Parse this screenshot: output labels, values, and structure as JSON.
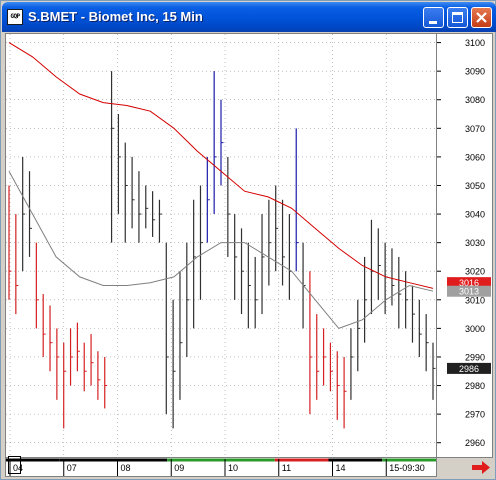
{
  "window": {
    "title": "S.BMET - Biomet Inc, 15 Min",
    "app_icon_text": "GQP"
  },
  "colors": {
    "up_bar": "#1a1aa8",
    "down_bar": "#d42020",
    "neutral_bar": "#303030",
    "moving_average_long": "#d40000",
    "moving_average_short": "#808080",
    "label_red_bg": "#e01c1c",
    "label_gray_bg": "#a0a0a0",
    "label_black_bg": "#202020"
  },
  "price_axis": {
    "ticks": [
      "3100",
      "3090",
      "3080",
      "3070",
      "3060",
      "3050",
      "3040",
      "3030",
      "3020",
      "3010",
      "3000",
      "2990",
      "2980",
      "2970",
      "2960"
    ],
    "tick_values": [
      3100,
      3090,
      3080,
      3070,
      3060,
      3050,
      3040,
      3030,
      3020,
      3010,
      3000,
      2990,
      2980,
      2970,
      2960
    ],
    "markers": [
      {
        "label": "3016",
        "value": 3016,
        "style": "red"
      },
      {
        "label": "3013",
        "value": 3013,
        "style": "gray"
      },
      {
        "label": "2986",
        "value": 2986,
        "style": "black"
      }
    ]
  },
  "time_axis": {
    "labels": [
      "04",
      "07",
      "08",
      "09",
      "10",
      "11",
      "14",
      "15-09:30"
    ],
    "segment_colors": [
      "#000000",
      "#000000",
      "#000000",
      "#2a9a2a",
      "#2a9a2a",
      "#d42020",
      "#000000",
      "#2a9a2a"
    ]
  },
  "chart_data": {
    "type": "line",
    "y_range": [
      2955,
      3103
    ],
    "grid": true,
    "series": [
      {
        "style": "ohlc-bars",
        "bars": [
          {
            "x": 0,
            "h": 3050,
            "l": 3010,
            "c": 3020,
            "col": "down"
          },
          {
            "x": 1,
            "h": 3040,
            "l": 3005,
            "c": 3015,
            "col": "down"
          },
          {
            "x": 2,
            "h": 3060,
            "l": 3020,
            "c": 3040,
            "col": "neutral"
          },
          {
            "x": 3,
            "h": 3055,
            "l": 3025,
            "c": 3035,
            "col": "neutral"
          },
          {
            "x": 4,
            "h": 3030,
            "l": 3000,
            "c": 3010,
            "col": "down"
          },
          {
            "x": 5,
            "h": 3012,
            "l": 2990,
            "c": 2998,
            "col": "down"
          },
          {
            "x": 6,
            "h": 3008,
            "l": 2985,
            "c": 2995,
            "col": "down"
          },
          {
            "x": 7,
            "h": 3000,
            "l": 2975,
            "c": 2990,
            "col": "down"
          },
          {
            "x": 8,
            "h": 2995,
            "l": 2965,
            "c": 2985,
            "col": "down"
          },
          {
            "x": 9,
            "h": 3000,
            "l": 2980,
            "c": 2990,
            "col": "down"
          },
          {
            "x": 10,
            "h": 3002,
            "l": 2985,
            "c": 2992,
            "col": "down"
          },
          {
            "x": 11,
            "h": 2995,
            "l": 2978,
            "c": 2985,
            "col": "down"
          },
          {
            "x": 12,
            "h": 2998,
            "l": 2980,
            "c": 2988,
            "col": "down"
          },
          {
            "x": 13,
            "h": 2992,
            "l": 2975,
            "c": 2982,
            "col": "down"
          },
          {
            "x": 14,
            "h": 2990,
            "l": 2972,
            "c": 2980,
            "col": "down"
          },
          {
            "x": 15,
            "h": 3090,
            "l": 3030,
            "c": 3070,
            "col": "neutral"
          },
          {
            "x": 16,
            "h": 3075,
            "l": 3040,
            "c": 3060,
            "col": "neutral"
          },
          {
            "x": 17,
            "h": 3065,
            "l": 3030,
            "c": 3050,
            "col": "neutral"
          },
          {
            "x": 18,
            "h": 3060,
            "l": 3035,
            "c": 3045,
            "col": "neutral"
          },
          {
            "x": 19,
            "h": 3055,
            "l": 3030,
            "c": 3040,
            "col": "neutral"
          },
          {
            "x": 20,
            "h": 3050,
            "l": 3035,
            "c": 3042,
            "col": "neutral"
          },
          {
            "x": 21,
            "h": 3048,
            "l": 3032,
            "c": 3038,
            "col": "neutral"
          },
          {
            "x": 22,
            "h": 3045,
            "l": 3030,
            "c": 3040,
            "col": "neutral"
          },
          {
            "x": 23,
            "h": 3030,
            "l": 2970,
            "c": 2990,
            "col": "neutral"
          },
          {
            "x": 24,
            "h": 3010,
            "l": 2965,
            "c": 2985,
            "col": "neutral"
          },
          {
            "x": 25,
            "h": 3020,
            "l": 2975,
            "c": 2995,
            "col": "neutral"
          },
          {
            "x": 26,
            "h": 3030,
            "l": 2990,
            "c": 3010,
            "col": "neutral"
          },
          {
            "x": 27,
            "h": 3045,
            "l": 3000,
            "c": 3025,
            "col": "neutral"
          },
          {
            "x": 28,
            "h": 3050,
            "l": 3010,
            "c": 3030,
            "col": "neutral"
          },
          {
            "x": 29,
            "h": 3060,
            "l": 3030,
            "c": 3045,
            "col": "up"
          },
          {
            "x": 30,
            "h": 3090,
            "l": 3040,
            "c": 3060,
            "col": "up"
          },
          {
            "x": 31,
            "h": 3080,
            "l": 3050,
            "c": 3065,
            "col": "up"
          },
          {
            "x": 32,
            "h": 3060,
            "l": 3025,
            "c": 3040,
            "col": "neutral"
          },
          {
            "x": 33,
            "h": 3040,
            "l": 3010,
            "c": 3025,
            "col": "neutral"
          },
          {
            "x": 34,
            "h": 3035,
            "l": 3005,
            "c": 3020,
            "col": "neutral"
          },
          {
            "x": 35,
            "h": 3030,
            "l": 3000,
            "c": 3015,
            "col": "neutral"
          },
          {
            "x": 36,
            "h": 3025,
            "l": 3000,
            "c": 3010,
            "col": "neutral"
          },
          {
            "x": 37,
            "h": 3040,
            "l": 3005,
            "c": 3025,
            "col": "neutral"
          },
          {
            "x": 38,
            "h": 3045,
            "l": 3015,
            "c": 3030,
            "col": "neutral"
          },
          {
            "x": 39,
            "h": 3050,
            "l": 3020,
            "c": 3035,
            "col": "neutral"
          },
          {
            "x": 40,
            "h": 3045,
            "l": 3015,
            "c": 3025,
            "col": "neutral"
          },
          {
            "x": 41,
            "h": 3040,
            "l": 3010,
            "c": 3020,
            "col": "neutral"
          },
          {
            "x": 42,
            "h": 3070,
            "l": 3020,
            "c": 3030,
            "col": "up"
          },
          {
            "x": 43,
            "h": 3030,
            "l": 3000,
            "c": 3015,
            "col": "neutral"
          },
          {
            "x": 44,
            "h": 3020,
            "l": 2970,
            "c": 2990,
            "col": "down"
          },
          {
            "x": 45,
            "h": 3005,
            "l": 2975,
            "c": 2985,
            "col": "down"
          },
          {
            "x": 46,
            "h": 3000,
            "l": 2980,
            "c": 2990,
            "col": "down"
          },
          {
            "x": 47,
            "h": 2995,
            "l": 2978,
            "c": 2985,
            "col": "down"
          },
          {
            "x": 48,
            "h": 2992,
            "l": 2968,
            "c": 2980,
            "col": "down"
          },
          {
            "x": 49,
            "h": 2990,
            "l": 2965,
            "c": 2978,
            "col": "down"
          },
          {
            "x": 50,
            "h": 3000,
            "l": 2975,
            "c": 2990,
            "col": "neutral"
          },
          {
            "x": 51,
            "h": 3010,
            "l": 2985,
            "c": 3000,
            "col": "neutral"
          },
          {
            "x": 52,
            "h": 3025,
            "l": 2995,
            "c": 3010,
            "col": "neutral"
          },
          {
            "x": 53,
            "h": 3038,
            "l": 3005,
            "c": 3020,
            "col": "neutral"
          },
          {
            "x": 54,
            "h": 3035,
            "l": 3010,
            "c": 3022,
            "col": "neutral"
          },
          {
            "x": 55,
            "h": 3030,
            "l": 3005,
            "c": 3018,
            "col": "neutral"
          },
          {
            "x": 56,
            "h": 3028,
            "l": 3008,
            "c": 3015,
            "col": "neutral"
          },
          {
            "x": 57,
            "h": 3025,
            "l": 3000,
            "c": 3012,
            "col": "neutral"
          },
          {
            "x": 58,
            "h": 3020,
            "l": 3000,
            "c": 3010,
            "col": "neutral"
          },
          {
            "x": 59,
            "h": 3015,
            "l": 2995,
            "c": 3005,
            "col": "neutral"
          },
          {
            "x": 60,
            "h": 3010,
            "l": 2990,
            "c": 2998,
            "col": "neutral"
          },
          {
            "x": 61,
            "h": 3005,
            "l": 2985,
            "c": 2995,
            "col": "neutral"
          },
          {
            "x": 62,
            "h": 2995,
            "l": 2975,
            "c": 2986,
            "col": "neutral"
          }
        ]
      },
      {
        "style": "line",
        "color": "long",
        "values": [
          3100,
          3095,
          3088,
          3082,
          3079,
          3078,
          3076,
          3070,
          3062,
          3055,
          3048,
          3046,
          3042,
          3035,
          3028,
          3022,
          3018,
          3016,
          3014
        ]
      },
      {
        "style": "line",
        "color": "short",
        "values": [
          3055,
          3040,
          3025,
          3018,
          3015,
          3015,
          3016,
          3018,
          3025,
          3030,
          3030,
          3025,
          3020,
          3010,
          3000,
          3003,
          3010,
          3015,
          3013
        ]
      }
    ]
  }
}
